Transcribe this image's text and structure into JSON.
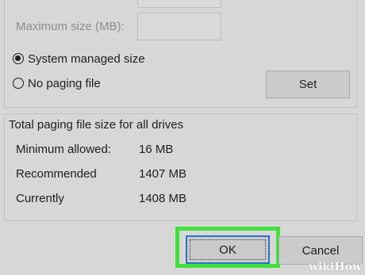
{
  "custom_size": {
    "maximum_size_label": "Maximum size (MB):",
    "initial_size_value": "",
    "maximum_size_value": ""
  },
  "options": {
    "system_managed_label": "System managed size",
    "no_paging_label": "No paging file",
    "selected": "system_managed"
  },
  "set_button_label": "Set",
  "totals": {
    "title": "Total paging file size for all drives",
    "rows": [
      {
        "label": "Minimum allowed:",
        "value": "16 MB"
      },
      {
        "label": "Recommended",
        "value": "1407 MB"
      },
      {
        "label": "Currently",
        "value": "1408 MB"
      }
    ]
  },
  "footer": {
    "ok_label": "OK",
    "cancel_label": "Cancel",
    "highlight_color": "#3fe13a"
  },
  "watermark": {
    "wiki": "wiki",
    "how": "How"
  }
}
